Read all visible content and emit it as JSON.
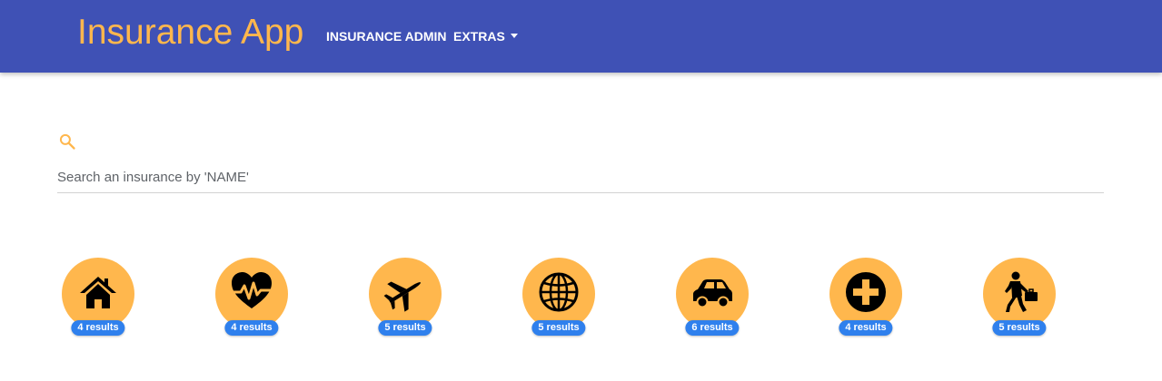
{
  "header": {
    "brand": "Insurance App",
    "nav_admin": "INSURANCE ADMIN",
    "nav_extras": "EXTRAS"
  },
  "search": {
    "placeholder": "Search an insurance by 'NAME'",
    "value": "",
    "icon": "search-icon"
  },
  "categories": [
    {
      "icon": "house-icon",
      "badge": "4 results"
    },
    {
      "icon": "heartbeat-icon",
      "badge": "4 results"
    },
    {
      "icon": "airplane-icon",
      "badge": "5 results"
    },
    {
      "icon": "globe-icon",
      "badge": "5 results"
    },
    {
      "icon": "car-icon",
      "badge": "6 results"
    },
    {
      "icon": "medical-cross-icon",
      "badge": "4 results"
    },
    {
      "icon": "businessman-icon",
      "badge": "5 results"
    }
  ],
  "colors": {
    "navbar": "#3f51b5",
    "accent": "#ffb74d",
    "badge": "#2f80ed"
  }
}
